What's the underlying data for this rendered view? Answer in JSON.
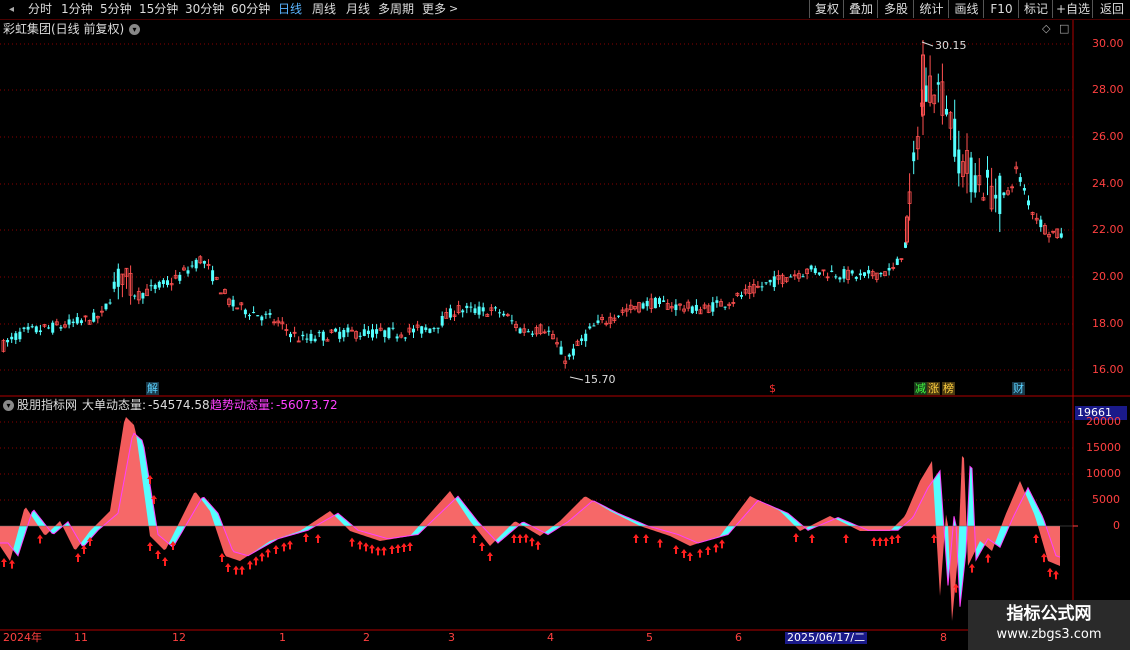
{
  "toolbar": {
    "periods": [
      "分时",
      "1分钟",
      "5分钟",
      "15分钟",
      "30分钟",
      "60分钟",
      "日线",
      "周线",
      "月线",
      "多周期",
      "更多"
    ],
    "active_period": "日线",
    "right_buttons": [
      "复权",
      "叠加",
      "多股",
      "统计",
      "画线",
      "F10",
      "标记",
      "+自选",
      "返回"
    ]
  },
  "main_panel": {
    "stock_title": "彩虹集团(日线 前复权)",
    "high_label": "30.15",
    "low_label": "15.70",
    "y_ticks": [
      "30.00",
      "28.00",
      "26.00",
      "24.00",
      "22.00",
      "20.00",
      "18.00",
      "16.00"
    ],
    "event_markers": [
      {
        "text": "解",
        "color": "#5ad2ff"
      },
      {
        "text": "$",
        "color": "#ff3030"
      },
      {
        "text": "减",
        "color": "#40ff40"
      },
      {
        "text": "涨",
        "color": "#ffd040"
      },
      {
        "text": "榜",
        "color": "#ffd040"
      },
      {
        "text": "财",
        "color": "#5ad2ff"
      }
    ]
  },
  "indicator_panel": {
    "source_name": "股朋指标网",
    "label1": "大单动态量:",
    "value1": "-54574.58",
    "label2": "趋势动态量:",
    "value2": "-56073.72",
    "box_value": "19661",
    "y_ticks": [
      "20000",
      "15000",
      "10000",
      "5000",
      "0"
    ]
  },
  "x_axis": {
    "labels": [
      "2024年",
      "11",
      "12",
      "1",
      "2",
      "3",
      "4",
      "5",
      "6",
      "2025/06/17/二",
      "8"
    ]
  },
  "watermark": {
    "line1": "指标公式网",
    "line2": "www.zbgs3.com"
  },
  "colors": {
    "up": "#ff5050",
    "down": "#54ffff",
    "grid": "#8a0000",
    "active_tab": "#5ab4ff",
    "line2": "#ff40ff"
  }
}
